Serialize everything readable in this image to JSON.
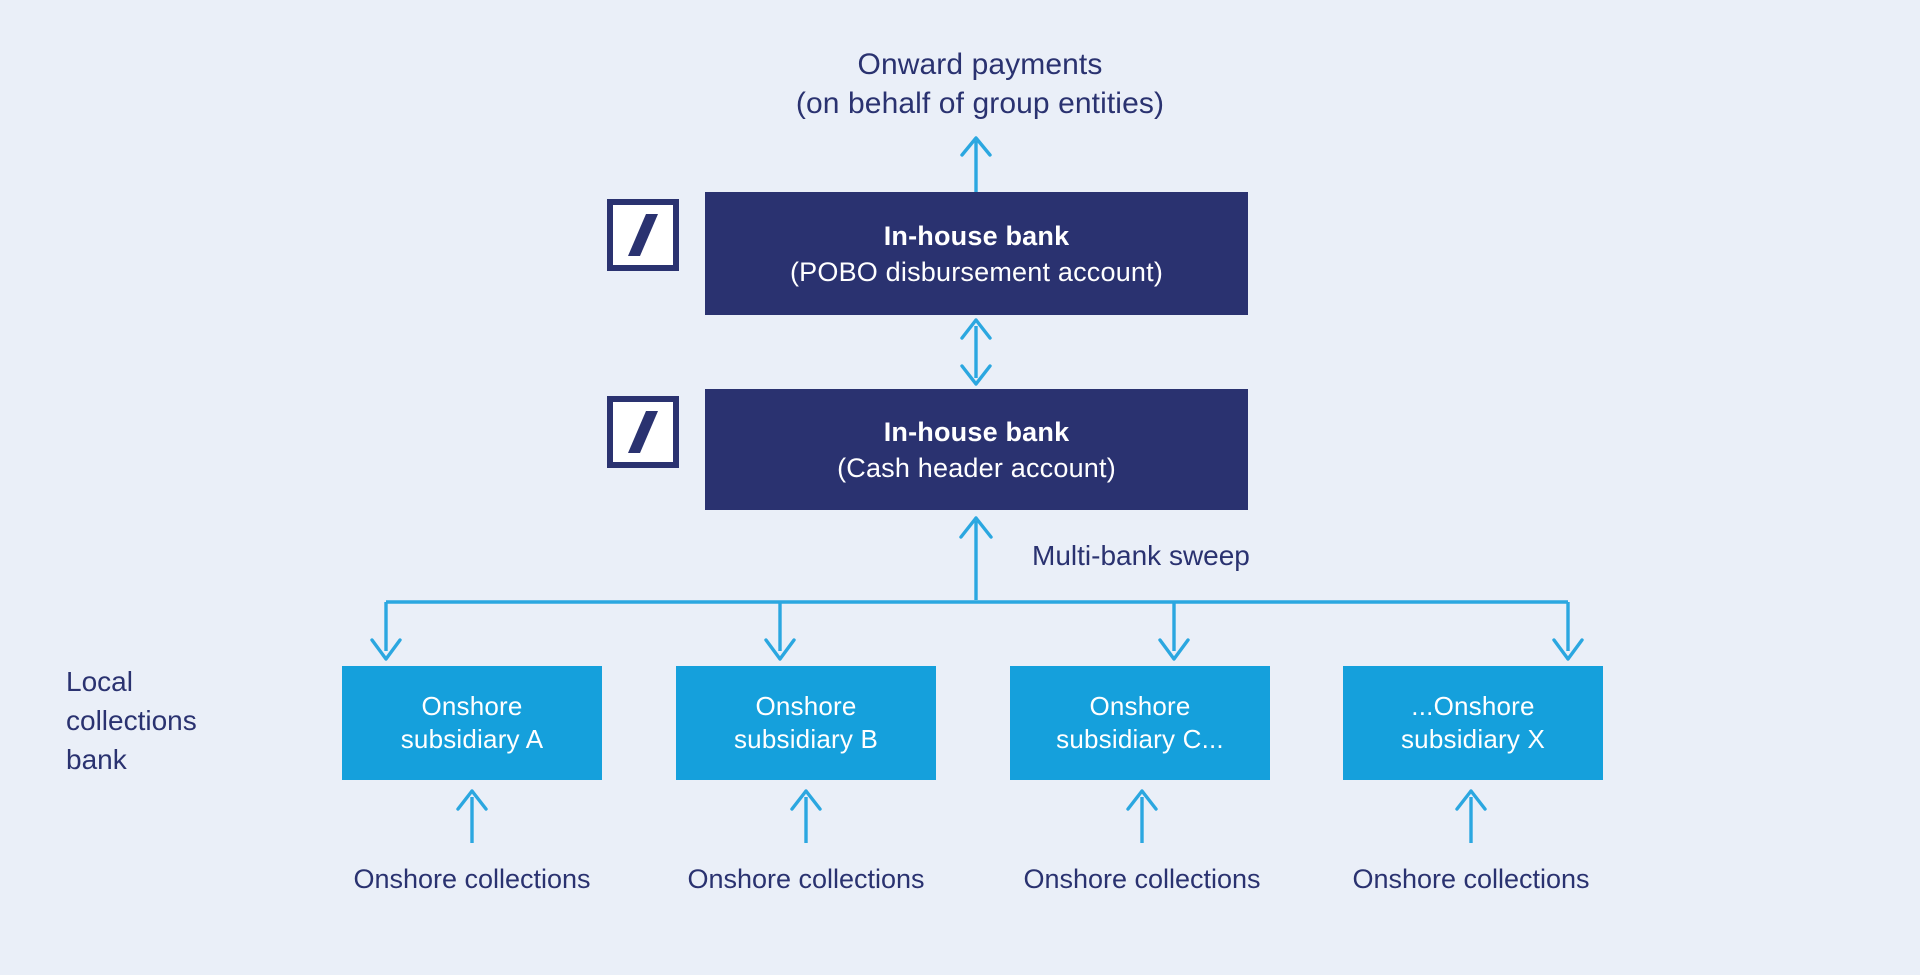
{
  "colors": {
    "background": "#eaeff8",
    "navy": "#2a3270",
    "light_blue": "#15a0dc",
    "arrow_blue": "#2ba7e0",
    "text_navy": "#2a3270",
    "white": "#ffffff"
  },
  "top_caption": {
    "line1": "Onward payments",
    "line2": "(on behalf of group entities)"
  },
  "boxes": {
    "pobo": {
      "title": "In-house bank",
      "subtitle": "(POBO disbursement account)",
      "logo": "deutsche-bank-logo"
    },
    "cash_header": {
      "title": "In-house bank",
      "subtitle": "(Cash header account)",
      "logo": "deutsche-bank-logo"
    }
  },
  "sweep_label": "Multi-bank sweep",
  "side_label": {
    "line1": "Local",
    "line2": "collections",
    "line3": "bank"
  },
  "subsidiaries": [
    {
      "line1": "Onshore",
      "line2": "subsidiary A",
      "collections": "Onshore collections"
    },
    {
      "line1": "Onshore",
      "line2": "subsidiary B",
      "collections": "Onshore collections"
    },
    {
      "line1": "Onshore",
      "line2": "subsidiary C...",
      "collections": "Onshore collections"
    },
    {
      "line1": "...Onshore",
      "line2": "subsidiary X",
      "collections": "Onshore collections"
    }
  ]
}
